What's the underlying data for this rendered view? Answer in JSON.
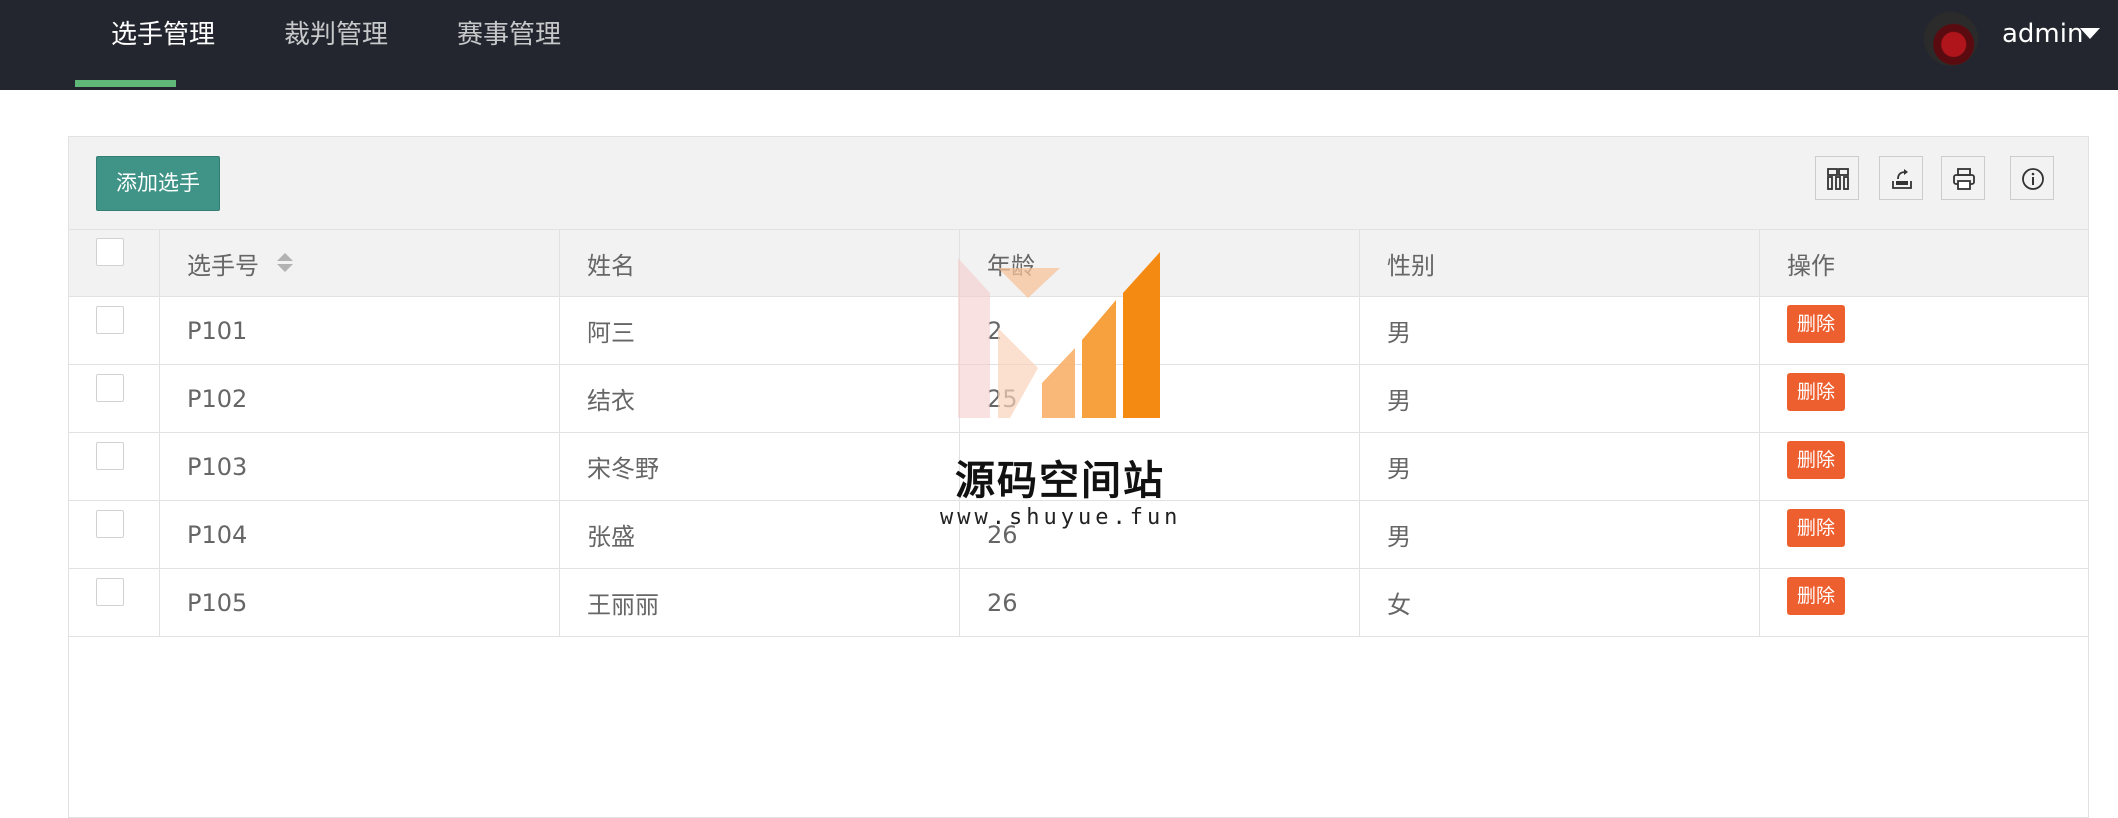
{
  "nav": {
    "tabs": [
      {
        "label": "选手管理",
        "active": true
      },
      {
        "label": "裁判管理",
        "active": false
      },
      {
        "label": "赛事管理",
        "active": false
      }
    ],
    "user": {
      "name": "admin",
      "avatar_icon": "avatar-rose"
    },
    "underline_color": "#5fb878"
  },
  "toolbar": {
    "add_label": "添加选手",
    "tools": [
      "columns-icon",
      "export-icon",
      "print-icon",
      "info-icon"
    ]
  },
  "table": {
    "columns": [
      "选手号",
      "姓名",
      "年龄",
      "性别",
      "操作"
    ],
    "rows": [
      {
        "id": "P101",
        "name": "阿三",
        "age": "2",
        "gender": "男",
        "action": "删除"
      },
      {
        "id": "P102",
        "name": "结衣",
        "age": "25",
        "gender": "男",
        "action": "删除"
      },
      {
        "id": "P103",
        "name": "宋冬野",
        "age": "",
        "gender": "男",
        "action": "删除"
      },
      {
        "id": "P104",
        "name": "张盛",
        "age": "26",
        "gender": "男",
        "action": "删除"
      },
      {
        "id": "P105",
        "name": "王丽丽",
        "age": "26",
        "gender": "女",
        "action": "删除"
      }
    ]
  },
  "watermark": {
    "title": "源码空间站",
    "url": "www.shuyue.fun"
  },
  "colors": {
    "primary": "#3f9487",
    "danger": "#ee5f2f",
    "nav_bg": "#23262e"
  }
}
